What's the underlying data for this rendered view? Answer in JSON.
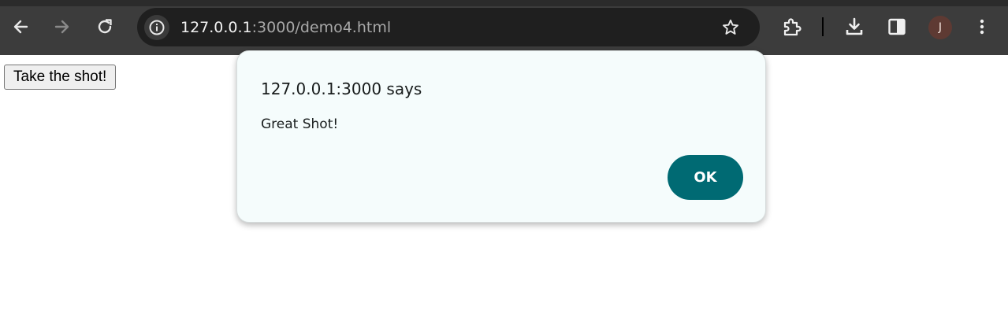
{
  "browser": {
    "back_icon": "arrow-left",
    "forward_icon": "arrow-right",
    "reload_icon": "reload",
    "address": {
      "host": "127.0.0.1",
      "rest": ":3000/demo4.html"
    },
    "avatar_letter": "J"
  },
  "page": {
    "button_label": "Take the shot!"
  },
  "dialog": {
    "title": "127.0.0.1:3000 says",
    "message": "Great Shot!",
    "ok_label": "OK"
  },
  "colors": {
    "toolbar": "#3c3c3c",
    "omnibox": "#1f1f1f",
    "dialog_bg": "#f5fcfc",
    "ok_button": "#006a73",
    "avatar": "#5e3a33"
  }
}
